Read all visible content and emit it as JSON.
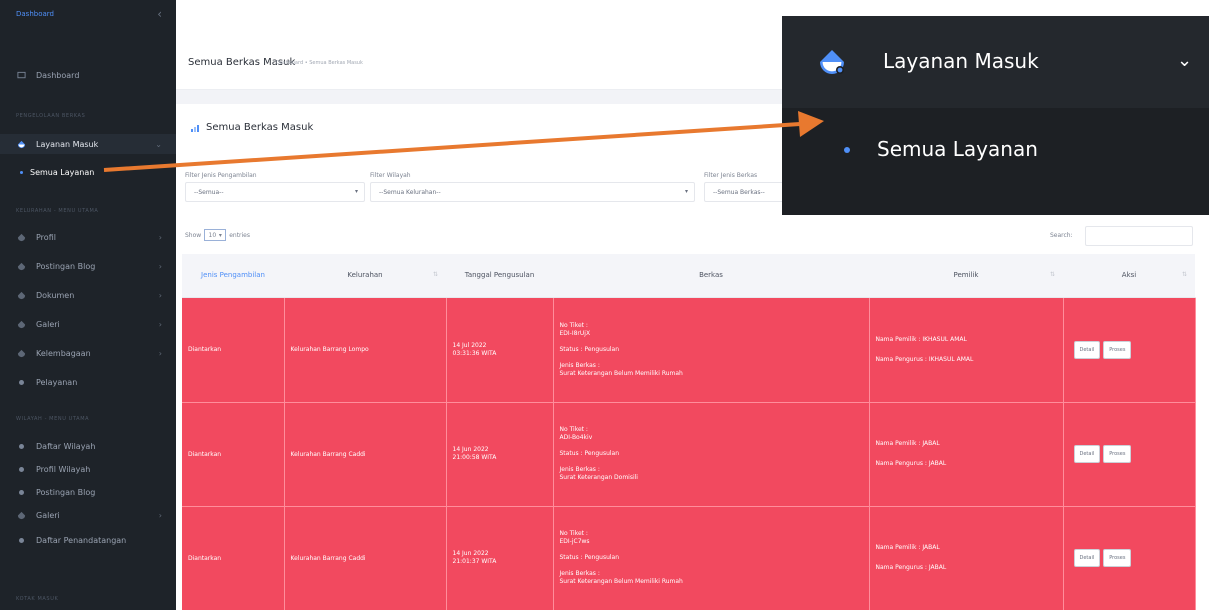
{
  "sidebar": {
    "brand": "Dashboard",
    "collapse_icon": "chevron-left-icon",
    "dashboard": "Dashboard",
    "section1": "PENGELOLAAN BERKAS",
    "layanan_masuk": "Layanan Masuk",
    "semua_layanan": "Semua Layanan",
    "section2": "KELURAHAN - MENU UTAMA",
    "profil": "Profil",
    "postingan_blog": "Postingan Blog",
    "dokumen": "Dokumen",
    "galeri": "Galeri",
    "kelembagaan": "Kelembagaan",
    "pelayanan": "Pelayanan",
    "section3": "WILAYAH - MENU UTAMA",
    "daftar_wilayah": "Daftar Wilayah",
    "profil_wilayah": "Profil Wilayah",
    "postingan_blog2": "Postingan Blog",
    "galeri2": "Galeri",
    "daftar_penandatangan": "Daftar Penandatangan",
    "section4": "KOTAK MASUK"
  },
  "topbar": {
    "title": "Semua Berkas Masuk",
    "breadcrumb": "Dashboard  •  Semua Berkas Masuk"
  },
  "card": {
    "title": "Semua Berkas Masuk"
  },
  "filters": {
    "pengambilan_label": "Filter Jenis Pengambilan",
    "pengambilan_value": "--Semua--",
    "wilayah_label": "Filter Wilayah",
    "wilayah_value": "--Semua Kelurahan--",
    "berkas_label": "Filter Jenis Berkas",
    "berkas_value": "--Semua Berkas--"
  },
  "table_controls": {
    "show": "Show",
    "entries_value": "10",
    "entries": "entries",
    "search": "Search:"
  },
  "table": {
    "headers": [
      "Jenis Pengambilan",
      "Kelurahan",
      "Tanggal Pengusulan",
      "Berkas",
      "Pemilik",
      "Aksi"
    ],
    "rows": [
      {
        "jenis": "Diantarkan",
        "kelurahan": "Kelurahan Barrang Lompo",
        "tanggal": "14 Jul 2022",
        "jam": "03:31:36 WITA",
        "tiket_label": "No Tiket :",
        "tiket": "EDI-I8rUjX",
        "status": "Status : Pengusulan",
        "jenis_berkas_label": "Jenis Berkas :",
        "jenis_berkas": "Surat Keterangan Belum Memiliki Rumah",
        "pemilik": "Nama Pemilik : IKHASUL AMAL",
        "pengurus": "Nama Pengurus : IKHASUL AMAL",
        "detail": "Detail",
        "proses": "Proses"
      },
      {
        "jenis": "Diantarkan",
        "kelurahan": "Kelurahan Barrang Caddi",
        "tanggal": "14 Jun 2022",
        "jam": "21:00:58 WITA",
        "tiket_label": "No Tiket :",
        "tiket": "ADI-Bo4kiv",
        "status": "Status : Pengusulan",
        "jenis_berkas_label": "Jenis Berkas :",
        "jenis_berkas": "Surat Keterangan Domisili",
        "pemilik": "Nama Pemilik : JABAL",
        "pengurus": "Nama Pengurus : JABAL",
        "detail": "Detail",
        "proses": "Proses"
      },
      {
        "jenis": "Diantarkan",
        "kelurahan": "Kelurahan Barrang Caddi",
        "tanggal": "14 Jun 2022",
        "jam": "21:01:37 WITA",
        "tiket_label": "No Tiket :",
        "tiket": "EDI-jC7ws",
        "status": "Status : Pengusulan",
        "jenis_berkas_label": "Jenis Berkas :",
        "jenis_berkas": "Surat Keterangan Belum Memiliki Rumah",
        "pemilik": "Nama Pemilik : JABAL",
        "pengurus": "Nama Pengurus : JABAL",
        "detail": "Detail",
        "proses": "Proses"
      }
    ]
  },
  "zoom": {
    "layanan_masuk": "Layanan Masuk",
    "semua_layanan": "Semua Layanan"
  },
  "colors": {
    "row_highlight": "#f2495f",
    "sidebar_bg": "#1e2329",
    "accent": "#4f8ff7",
    "annotation_arrow": "#e8792f"
  }
}
